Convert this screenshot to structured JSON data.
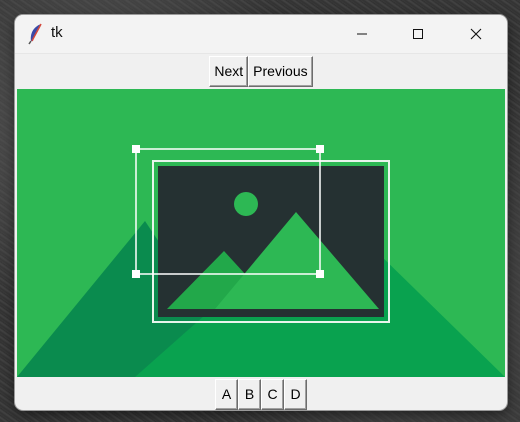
{
  "window": {
    "title": "tk",
    "icons": {
      "app": "feather-icon",
      "minimize": "minimize-icon",
      "maximize": "maximize-icon",
      "close": "close-icon"
    }
  },
  "nav_buttons": {
    "next": "Next",
    "previous": "Previous"
  },
  "canvas": {
    "image": "placeholder-image-icon",
    "background_color": "#2db854",
    "selection_color": "#ffffff"
  },
  "letter_buttons": [
    "A",
    "B",
    "C",
    "D"
  ]
}
